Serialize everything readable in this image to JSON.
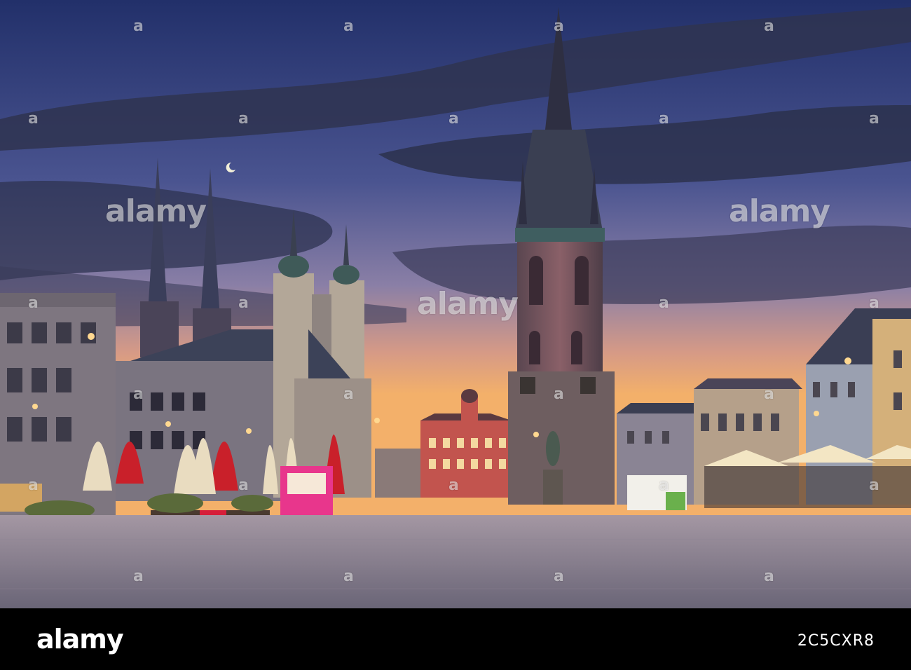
{
  "watermark": {
    "brand": "alamy",
    "letter": "a"
  },
  "footer": {
    "logo": "alamy",
    "image_id": "2C5CXR8"
  },
  "palette": {
    "sky_top": "#2b3a6e",
    "sky_mid": "#5a5f8e",
    "sunset": "#f2a560",
    "tower": "#7a5a62",
    "plaza": "#8c8598"
  }
}
